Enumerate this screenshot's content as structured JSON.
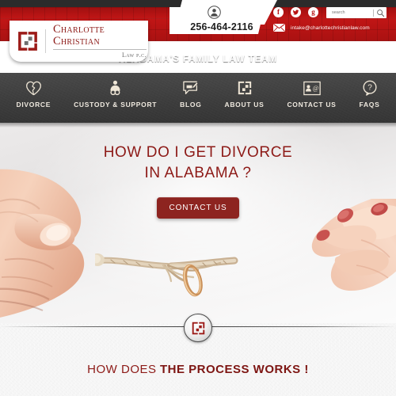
{
  "topbar": {
    "avatar_icon": "person-icon",
    "phone": "256-464-2116",
    "email": "intake@charlottechristianlaw.com",
    "email_icon": "envelope-icon",
    "search": {
      "placeholder": "search",
      "value": "",
      "icon": "magnifier-icon"
    },
    "social": [
      {
        "name": "facebook",
        "glyph": "f"
      },
      {
        "name": "twitter",
        "glyph": "✔"
      },
      {
        "name": "google-plus",
        "glyph": "g"
      }
    ]
  },
  "logo": {
    "mark_icon": "charlotte-christian-logo-mark",
    "line1": "Charlotte Christian",
    "line2": "Law p.c."
  },
  "tagline": "ALABAMA'S FAMILY LAW  TEAM",
  "nav": [
    {
      "label": "DIVORCE",
      "icon": "broken-heart-icon"
    },
    {
      "label": "CUSTODY & SUPPORT",
      "icon": "parent-child-icon"
    },
    {
      "label": "BLOG",
      "icon": "speech-bubble-pencil-icon"
    },
    {
      "label": "ABOUT US",
      "icon": "logo-square-icon"
    },
    {
      "label": "CONTACT US",
      "icon": "contact-card-icon"
    },
    {
      "label": "FAQS",
      "icon": "question-bubble-icon"
    }
  ],
  "hero": {
    "headline_line1": "HOW DO I GET DIVORCE",
    "headline_line2": "IN ALABAMA ?",
    "cta_label": "CONTACT US",
    "image_alt": "two-hands-pulling-fraying-rope-with-wedding-ring"
  },
  "divider": {
    "badge_icon": "charlotte-christian-logo-mark"
  },
  "process": {
    "text_light": "HOW DOES",
    "text_bold": "THE PROCESS  WORKS !"
  },
  "colors": {
    "brand_red": "#b81212",
    "deep_red": "#8d1a17",
    "button_red": "#8d2420",
    "nav_dark": "#3e3e3e",
    "top_strip": "#2b2b2b"
  }
}
